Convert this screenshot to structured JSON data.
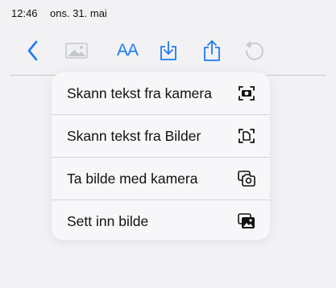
{
  "status_bar": {
    "time": "12:46",
    "date": "ons. 31. mai"
  },
  "toolbar": {
    "text_size_label": "AA",
    "accent_color": "#1d7af2",
    "disabled_color": "#c4c8cf",
    "icons": [
      "back-chevron-icon",
      "image-icon",
      "text-size-icon",
      "download-tray-icon",
      "share-icon",
      "undo-icon"
    ]
  },
  "menu": {
    "items": [
      {
        "label": "Skann tekst fra kamera",
        "icon": "camera-scan-icon"
      },
      {
        "label": "Skann tekst fra Bilder",
        "icon": "document-scan-icon"
      },
      {
        "label": "Ta bilde med kamera",
        "icon": "camera-icon"
      },
      {
        "label": "Sett inn bilde",
        "icon": "photo-icon"
      }
    ]
  }
}
